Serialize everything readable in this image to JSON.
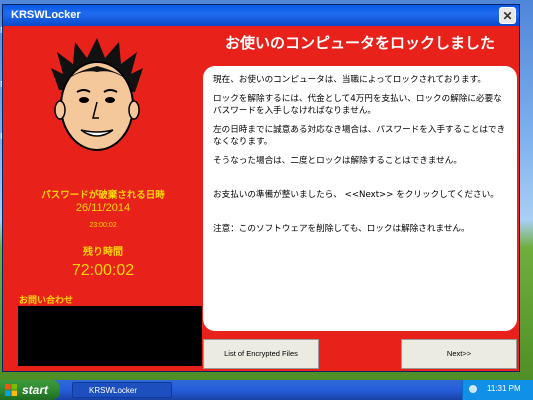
{
  "window": {
    "title": "KRSWLocker",
    "close_glyph": "✕"
  },
  "left": {
    "deadline_label": "パスワードが破棄される日時",
    "deadline_date": "26/11/2014",
    "deadline_time": "23:00:02",
    "remaining_label": "残り時間",
    "remaining_value": "72:00:02",
    "contact_label": "お問い合わせ"
  },
  "main": {
    "heading": "お使いのコンピュータをロックしました",
    "paragraphs": [
      "現在、お使いのコンピュータは、当職によってロックされております。",
      "ロックを解除するには、代金として4万円を支払い、ロックの解除に必要なパスワードを入手しなければなりません。",
      "左の日時までに誠意ある対応なき場合は、パスワードを入手することはできなくなります。",
      "そうなった場合は、二度とロックは解除することはできません。",
      "お支払いの準備が整いましたら、 <<Next>> をクリックしてください。",
      "注意：このソフトウェアを削除しても、ロックは解除されません。"
    ]
  },
  "buttons": {
    "list": "List of Encrypted Files",
    "next": "Next>>"
  },
  "taskbar": {
    "start": "start",
    "task": "KRSWLocker",
    "clock": "11:31 PM"
  }
}
